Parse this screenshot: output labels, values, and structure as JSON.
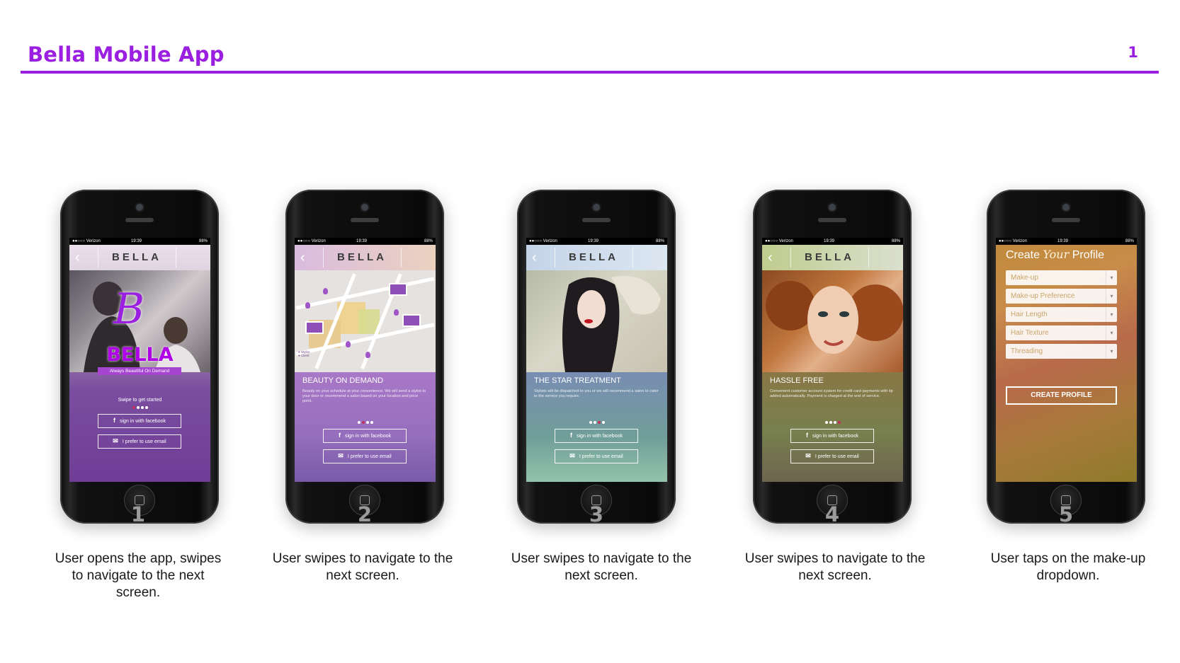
{
  "header": {
    "title": "Bella Mobile App",
    "page_number": "1"
  },
  "colors": {
    "accent": "#9b1fe0"
  },
  "status_bar": {
    "carrier": "●●○○○ Verizon",
    "time": "19:39",
    "battery": "88%"
  },
  "app": {
    "brand": "BELLA",
    "back_icon": "chevron-left-icon"
  },
  "screens": [
    {
      "logo_text": "BELLA",
      "logo_letter": "B",
      "tagline": "Always Beautiful On Demand",
      "swipe_label": "Swipe to get started",
      "facebook_button": "sign in with facebook",
      "email_button": "I prefer to use email"
    },
    {
      "panel_title": "BEAUTY ON DEMAND",
      "panel_body": "Beauty on your schedule at your convenience. We will send a stylist to your door or recommend a salon based on your location and price point.",
      "legend_stylist": "Stylist",
      "legend_client": "Client",
      "facebook_button": "sign in with facebook",
      "email_button": "I prefer to use email"
    },
    {
      "panel_title": "THE STAR TREATMENT",
      "panel_body": "Stylists will be dispatched to you or we will recommend a salon to cater to the service you require.",
      "facebook_button": "sign in with facebook",
      "email_button": "I prefer to use email"
    },
    {
      "panel_title": "HASSLE FREE",
      "panel_body": "Convenient customer account system for credit card payments with tip added automatically. Payment is charged at the end of service.",
      "facebook_button": "sign in with facebook",
      "email_button": "I prefer to use email"
    },
    {
      "title_before": "Create",
      "title_script": "Your",
      "title_after": "Profile",
      "fields": [
        "Make-up",
        "Make-up Preference",
        "Hair Length",
        "Hair Texture",
        "Threading"
      ],
      "create_button": "CREATE PROFILE"
    }
  ],
  "steps": [
    {
      "number": "1",
      "description": "User opens the app, swipes to navigate to the next screen."
    },
    {
      "number": "2",
      "description": "User swipes to navigate to the next screen."
    },
    {
      "number": "3",
      "description": "User swipes to navigate to the next screen."
    },
    {
      "number": "4",
      "description": "User swipes to navigate to the next screen."
    },
    {
      "number": "5",
      "description": "User taps on the make-up dropdown."
    }
  ]
}
